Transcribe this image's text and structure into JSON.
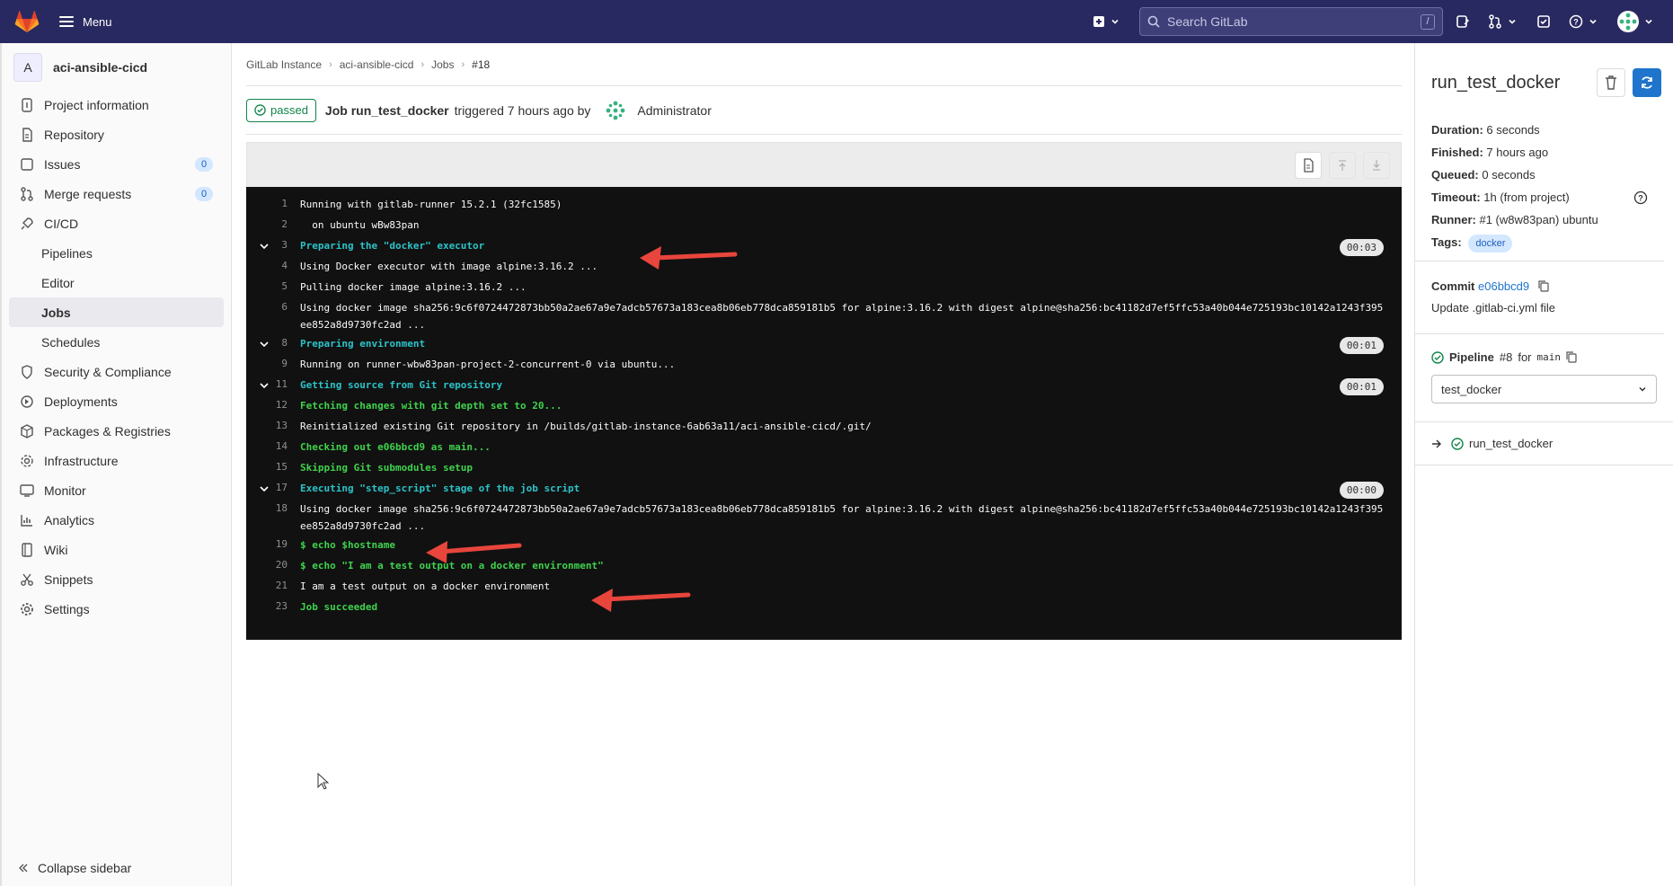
{
  "topbar": {
    "menu_label": "Menu",
    "search_placeholder": "Search GitLab",
    "search_shortcut": "/"
  },
  "sidebar": {
    "project_initial": "A",
    "project_name": "aci-ansible-cicd",
    "items": [
      {
        "label": "Project information",
        "icon": "info-icon"
      },
      {
        "label": "Repository",
        "icon": "doc-icon"
      },
      {
        "label": "Issues",
        "icon": "issues-icon",
        "badge": "0"
      },
      {
        "label": "Merge requests",
        "icon": "merge-icon",
        "badge": "0"
      },
      {
        "label": "CI/CD",
        "icon": "rocket-icon"
      },
      {
        "label": "Security & Compliance",
        "icon": "shield-icon"
      },
      {
        "label": "Deployments",
        "icon": "deploy-icon"
      },
      {
        "label": "Packages & Registries",
        "icon": "package-icon"
      },
      {
        "label": "Infrastructure",
        "icon": "cloud-icon"
      },
      {
        "label": "Monitor",
        "icon": "monitor-icon"
      },
      {
        "label": "Analytics",
        "icon": "chart-icon"
      },
      {
        "label": "Wiki",
        "icon": "book-icon"
      },
      {
        "label": "Snippets",
        "icon": "scissors-icon"
      },
      {
        "label": "Settings",
        "icon": "gear-icon"
      }
    ],
    "cicd_sub": [
      "Pipelines",
      "Editor",
      "Jobs",
      "Schedules"
    ],
    "collapse_label": "Collapse sidebar"
  },
  "breadcrumb": [
    "GitLab Instance",
    "aci-ansible-cicd",
    "Jobs",
    "#18"
  ],
  "job_header": {
    "status": "passed",
    "job_label": "Job run_test_docker",
    "triggered_text": "triggered 7 hours ago by",
    "user": "Administrator"
  },
  "log": [
    {
      "n": "1",
      "t": "Running with gitlab-runner 15.2.1 (32fc1585)",
      "kind": "plain"
    },
    {
      "n": "2",
      "t": "  on ubuntu wBw83pan",
      "kind": "plain"
    },
    {
      "n": "3",
      "t": "Preparing the \"docker\" executor",
      "kind": "section",
      "dur": "00:03"
    },
    {
      "n": "4",
      "t": "Using Docker executor with image alpine:3.16.2 ...",
      "kind": "plain"
    },
    {
      "n": "5",
      "t": "Pulling docker image alpine:3.16.2 ...",
      "kind": "plain"
    },
    {
      "n": "6",
      "t": "Using docker image sha256:9c6f0724472873bb50a2ae67a9e7adcb57673a183cea8b06eb778dca859181b5 for alpine:3.16.2 with digest alpine@sha256:bc41182d7ef5ffc53a40b044e725193bc10142a1243f395ee852a8d9730fc2ad ...",
      "kind": "plain"
    },
    {
      "n": "8",
      "t": "Preparing environment",
      "kind": "section",
      "dur": "00:01"
    },
    {
      "n": "9",
      "t": "Running on runner-wbw83pan-project-2-concurrent-0 via ubuntu...",
      "kind": "plain"
    },
    {
      "n": "11",
      "t": "Getting source from Git repository",
      "kind": "section",
      "dur": "00:01"
    },
    {
      "n": "12",
      "t": "Fetching changes with git depth set to 20...",
      "kind": "green"
    },
    {
      "n": "13",
      "t": "Reinitialized existing Git repository in /builds/gitlab-instance-6ab63a11/aci-ansible-cicd/.git/",
      "kind": "plain"
    },
    {
      "n": "14",
      "t": "Checking out e06bbcd9 as main...",
      "kind": "green"
    },
    {
      "n": "15",
      "t": "Skipping Git submodules setup",
      "kind": "green"
    },
    {
      "n": "17",
      "t": "Executing \"step_script\" stage of the job script",
      "kind": "section",
      "dur": "00:00"
    },
    {
      "n": "18",
      "t": "Using docker image sha256:9c6f0724472873bb50a2ae67a9e7adcb57673a183cea8b06eb778dca859181b5 for alpine:3.16.2 with digest alpine@sha256:bc41182d7ef5ffc53a40b044e725193bc10142a1243f395ee852a8d9730fc2ad ...",
      "kind": "plain"
    },
    {
      "n": "19",
      "t": "$ echo $hostname",
      "kind": "green"
    },
    {
      "n": "20",
      "t": "$ echo \"I am a test output on a docker environment\"",
      "kind": "green"
    },
    {
      "n": "21",
      "t": "I am a test output on a docker environment",
      "kind": "plain"
    },
    {
      "n": "23",
      "t": "Job succeeded",
      "kind": "green"
    }
  ],
  "right": {
    "title": "run_test_docker",
    "duration_label": "Duration:",
    "duration": "6 seconds",
    "finished_label": "Finished:",
    "finished": "7 hours ago",
    "queued_label": "Queued:",
    "queued": "0 seconds",
    "timeout_label": "Timeout:",
    "timeout": "1h (from project)",
    "runner_label": "Runner:",
    "runner": "#1 (w8w83pan) ubuntu",
    "tags_label": "Tags:",
    "tag": "docker",
    "commit_label": "Commit",
    "commit_sha": "e06bbcd9",
    "commit_msg": "Update .gitlab-ci.yml file",
    "pipeline_label": "Pipeline",
    "pipeline_num": "#8",
    "pipeline_for": "for",
    "pipeline_ref": "main",
    "stage_select": "test_docker",
    "job_link": "run_test_docker"
  },
  "colors": {
    "topbar": "#292961",
    "success": "#108548",
    "log_section": "#2bc3c8",
    "log_green": "#3fd24c",
    "annotation_arrow": "#e8453c",
    "retry_button": "#1f75cb"
  }
}
